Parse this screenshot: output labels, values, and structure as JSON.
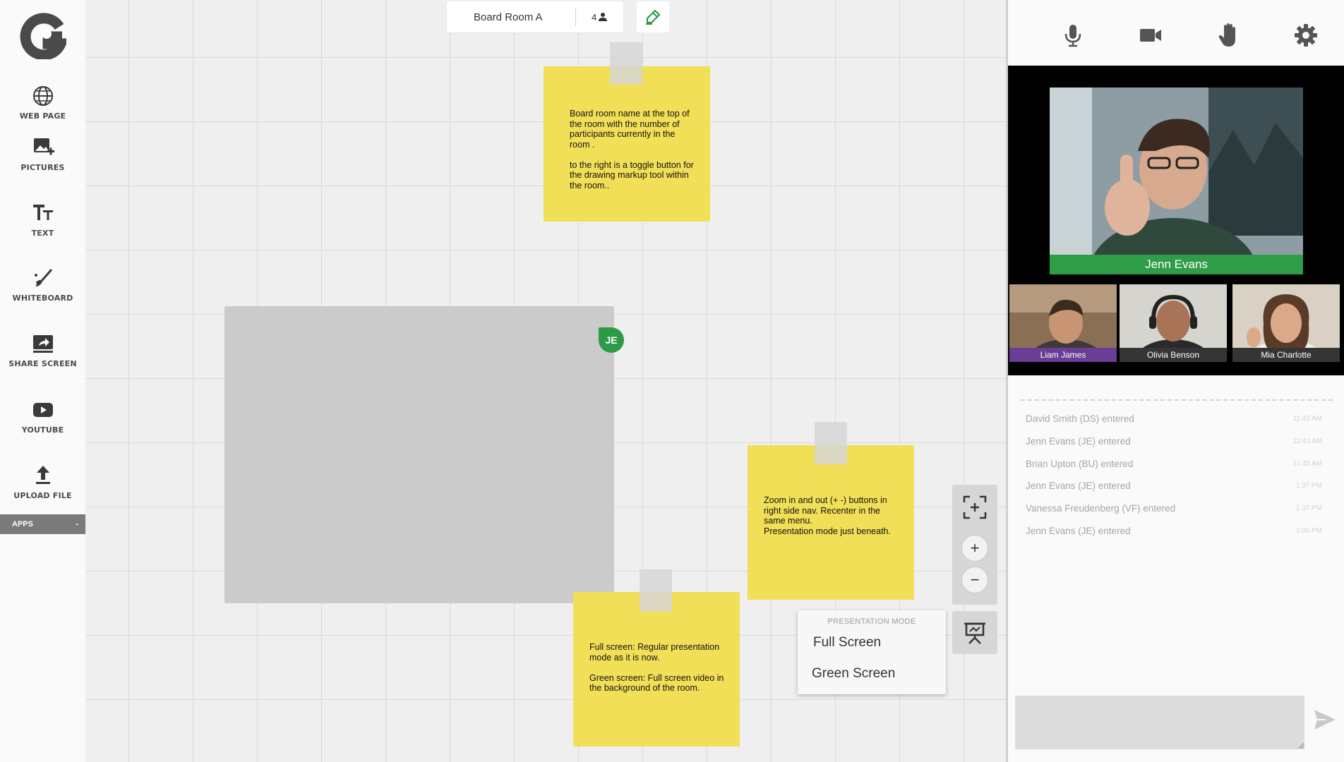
{
  "sidebar": {
    "tools": [
      {
        "id": "web-page",
        "label": "WEB PAGE",
        "icon": "globe-icon"
      },
      {
        "id": "pictures",
        "label": "PICTURES",
        "icon": "add-image-icon"
      },
      {
        "id": "text",
        "label": "TEXT",
        "icon": "text-icon"
      },
      {
        "id": "whiteboard",
        "label": "WHITEBOARD",
        "icon": "brush-icon"
      },
      {
        "id": "share-screen",
        "label": "SHARE SCREEN",
        "icon": "share-screen-icon"
      },
      {
        "id": "youtube",
        "label": "YOUTUBE",
        "icon": "youtube-icon"
      },
      {
        "id": "upload-file",
        "label": "UPLOAD FILE",
        "icon": "upload-icon"
      }
    ],
    "apps": {
      "label": "APPS",
      "toggle": "-"
    }
  },
  "room": {
    "name": "Board Room A",
    "participant_count": "4",
    "draw_toggle_icon": "marker-icon"
  },
  "notes": [
    {
      "text": "Board room name at the top of the room with the number of participants currently in the room .\n\nto the right is a toggle button for the drawing markup tool within the room.."
    },
    {
      "text": "Zoom in and out (+ -) buttons in right side nav. Recenter in the same menu.\nPresentation mode just beneath."
    },
    {
      "text": "Full screen: Regular presentation mode as it is now.\n\nGreen screen: Full screen video in the background of the room."
    }
  ],
  "cursor_badge": {
    "initials": "JE",
    "color": "#2d9a47"
  },
  "zoom": {
    "recenter_icon": "recenter-icon",
    "zoom_in": "+",
    "zoom_out": "−"
  },
  "presentation_menu": {
    "header": "PRESENTATION MODE",
    "options": [
      "Full Screen",
      "Green Screen"
    ],
    "button_icon": "presentation-icon"
  },
  "controls": [
    "microphone-icon",
    "camera-icon",
    "raise-hand-icon",
    "gear-icon"
  ],
  "video": {
    "main": {
      "name": "Jenn Evans",
      "label_color": "#2f9c4a"
    },
    "thumbnails": [
      {
        "name": "Liam James",
        "label_color": "#6a3d96"
      },
      {
        "name": "Olivia Benson",
        "label_color": "#353535"
      },
      {
        "name": "Mia Charlotte",
        "label_color": "#353535"
      }
    ]
  },
  "activity_log": [
    {
      "text": "David Smith (DS) entered",
      "time": "11:43 AM"
    },
    {
      "text": "Jenn Evans (JE) entered",
      "time": "11:43 AM"
    },
    {
      "text": "Brian Upton (BU) entered",
      "time": "11:45 AM"
    },
    {
      "text": "Jenn Evans (JE) entered",
      "time": "1:37 PM"
    },
    {
      "text": "Vanessa Freudenberg (VF) entered",
      "time": "1:37 PM"
    },
    {
      "text": "Jenn Evans (JE) entered",
      "time": "2:00 PM"
    }
  ],
  "chat": {
    "placeholder": "",
    "send_icon": "send-icon"
  },
  "colors": {
    "accent": "#2d9a47",
    "note": "#f2df58",
    "purple": "#6a3d96"
  }
}
